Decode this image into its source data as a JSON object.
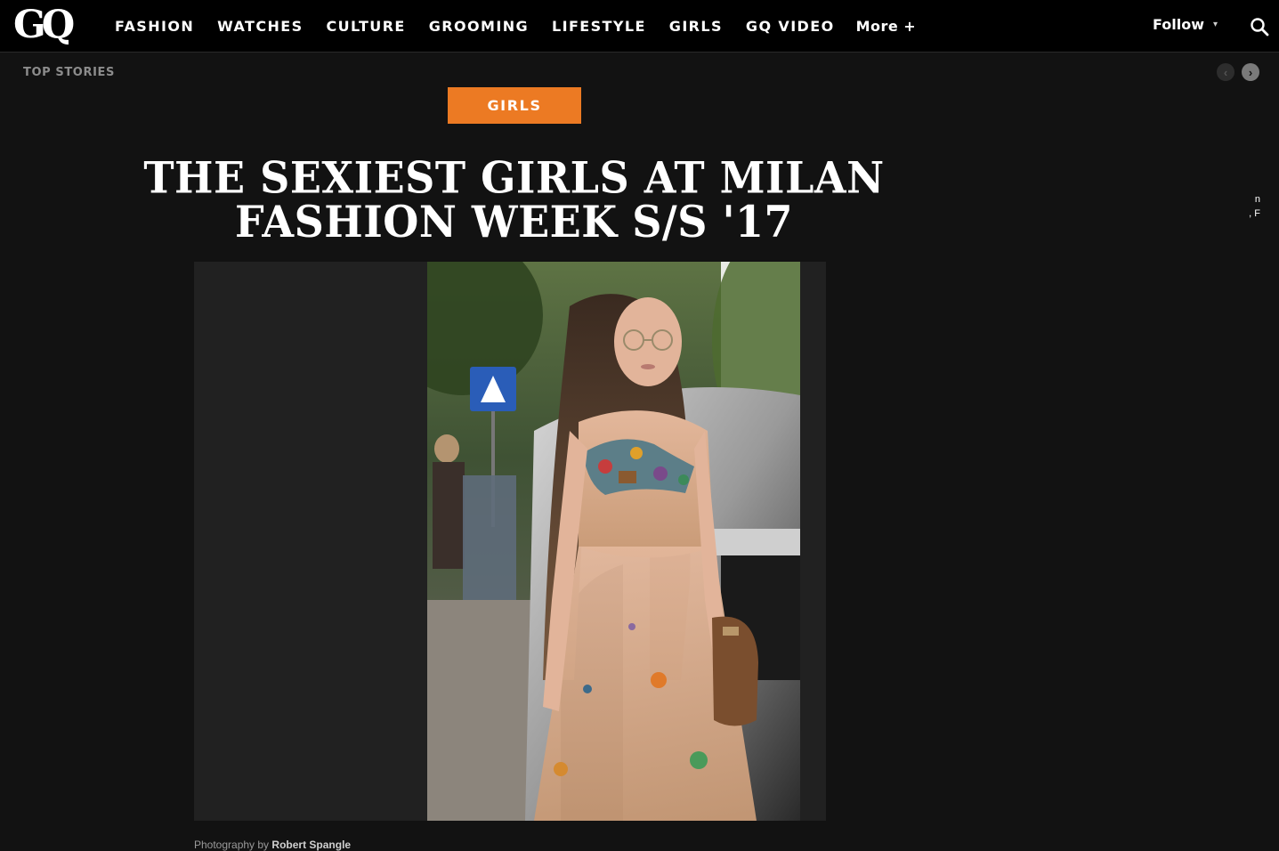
{
  "header": {
    "logo": "GQ",
    "nav": [
      {
        "label": "FASHION"
      },
      {
        "label": "WATCHES"
      },
      {
        "label": "CULTURE"
      },
      {
        "label": "GROOMING"
      },
      {
        "label": "LIFESTYLE"
      },
      {
        "label": "GIRLS"
      },
      {
        "label": "GQ VIDEO"
      }
    ],
    "more_label": "More +",
    "follow_label": "Follow",
    "follow_caret": "▾",
    "search_icon": "search-icon"
  },
  "top_stories": {
    "label": "TOP STORIES",
    "prev_icon": "chevron-left-icon",
    "next_icon": "chevron-right-icon",
    "prev_glyph": "‹",
    "next_glyph": "›"
  },
  "article": {
    "category": "GIRLS",
    "headline_line1": "THE SEXIEST GIRLS AT MILAN",
    "headline_line2": "FASHION WEEK S/S '17",
    "credit_prefix": "Photography by",
    "credit_name": "Robert Spangle"
  },
  "edge_fragment": {
    "line1": "",
    "line2": "n",
    "line3": ", F"
  },
  "colors": {
    "page_bg": "#121212",
    "header_bg": "#000000",
    "accent": "#ec7a23",
    "gallery_bg": "#212121"
  }
}
